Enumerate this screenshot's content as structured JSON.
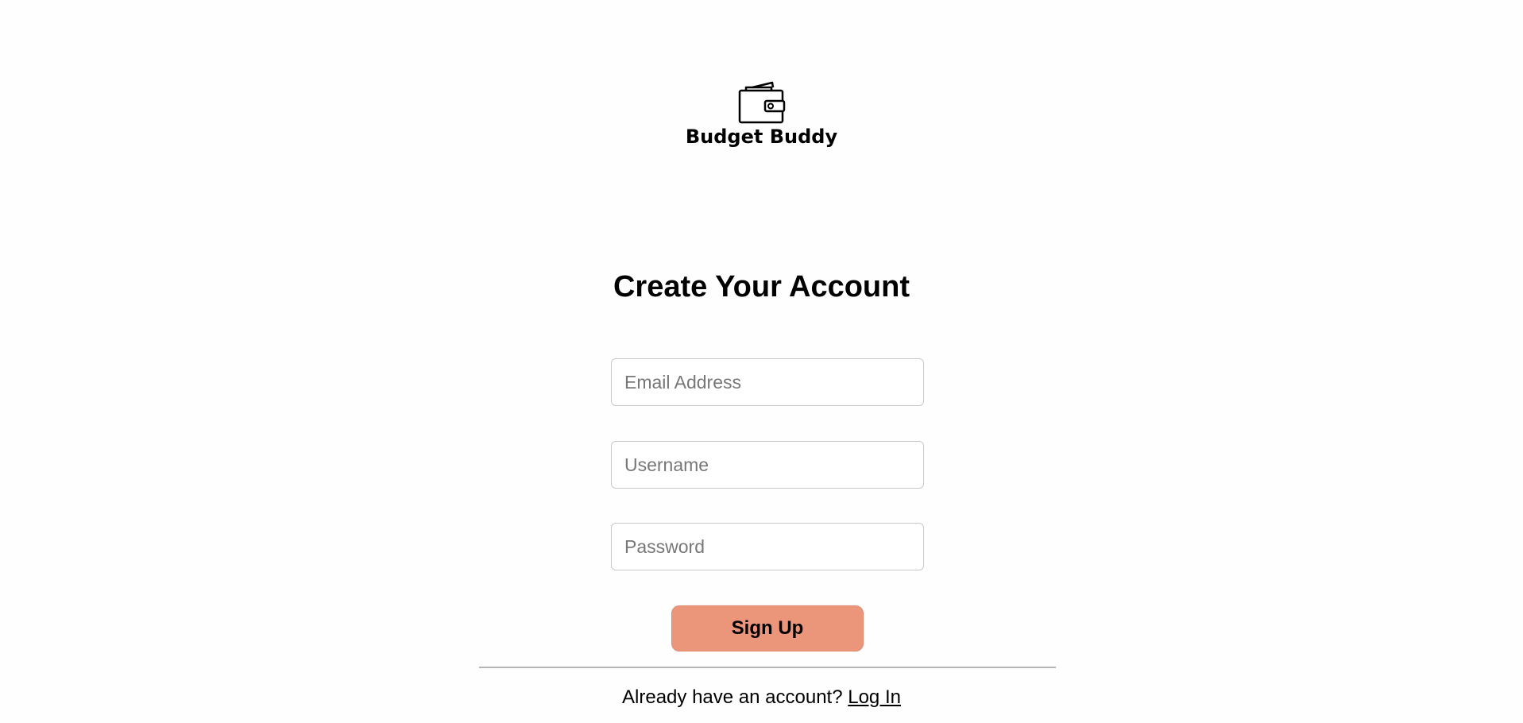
{
  "brand": {
    "name": "Budget Buddy",
    "icon": "wallet-icon"
  },
  "form": {
    "title": "Create Your Account",
    "email_placeholder": "Email Address",
    "email_value": "",
    "username_placeholder": "Username",
    "username_value": "",
    "password_placeholder": "Password",
    "password_value": "",
    "submit_label": "Sign Up"
  },
  "footer": {
    "prompt": "Already have an account?",
    "login_label": "Log In"
  },
  "colors": {
    "background": "#fefefe",
    "button": "#eb967a",
    "divider": "#b5b5b5",
    "field_border": "#c8c8c8"
  }
}
